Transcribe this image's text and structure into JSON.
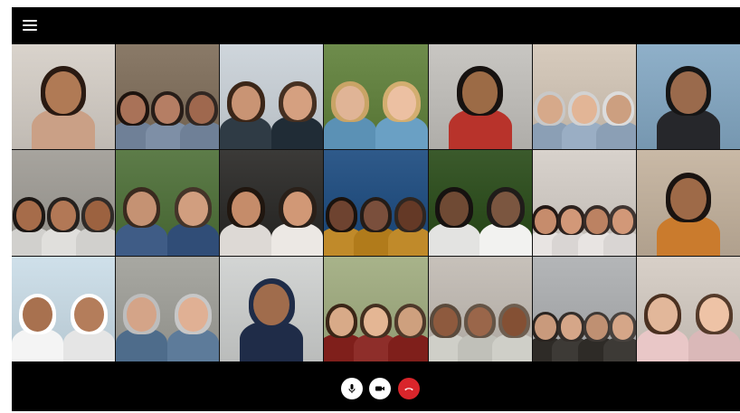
{
  "topbar": {
    "menu_icon": "hamburger-menu-icon"
  },
  "participants": [
    {
      "name": "participant-1",
      "bg": "#d9d3cc",
      "skin": "#b07a55",
      "hair": "#2a1a12",
      "shirt": "#caa086",
      "count": 1
    },
    {
      "name": "participant-2",
      "bg": "#8a7a68",
      "skin": "#a97258",
      "hair": "#1d130e",
      "shirt": "#7e8fa6",
      "count": 3
    },
    {
      "name": "participant-3",
      "bg": "#cfd6dc",
      "skin": "#c99474",
      "hair": "#3b2618",
      "shirt": "#2f3b45",
      "count": 2
    },
    {
      "name": "participant-4",
      "bg": "#6e8c4c",
      "skin": "#e0b496",
      "hair": "#c9a466",
      "shirt": "#6aa0c4",
      "count": 2
    },
    {
      "name": "participant-5",
      "bg": "#c8c6c2",
      "skin": "#9c6b46",
      "hair": "#171210",
      "shirt": "#b8332b",
      "count": 1
    },
    {
      "name": "participant-6",
      "bg": "#d7cbbd",
      "skin": "#d6a98a",
      "hair": "#c8c8c8",
      "shirt": "#9aaec4",
      "count": 3
    },
    {
      "name": "participant-7",
      "bg": "#8fb0c9",
      "skin": "#9a6a4c",
      "hair": "#151515",
      "shirt": "#26272b",
      "count": 1
    },
    {
      "name": "participant-8",
      "bg": "#a7a49e",
      "skin": "#a66c4a",
      "hair": "#1c1714",
      "shirt": "#e0dfdc",
      "count": 3
    },
    {
      "name": "participant-9",
      "bg": "#5d7c49",
      "skin": "#c59273",
      "hair": "#3a2a1f",
      "shirt": "#3f5c86",
      "count": 2
    },
    {
      "name": "participant-10",
      "bg": "#3b3a38",
      "skin": "#c58c6a",
      "hair": "#20160f",
      "shirt": "#ece8e4",
      "count": 2
    },
    {
      "name": "participant-11",
      "bg": "#2f5a8a",
      "skin": "#6e4330",
      "hair": "#1a120d",
      "shirt": "#c08a2a",
      "count": 3
    },
    {
      "name": "participant-12",
      "bg": "#3b5a2c",
      "skin": "#6f4a34",
      "hair": "#161210",
      "shirt": "#f2f2f0",
      "count": 2
    },
    {
      "name": "participant-13",
      "bg": "#d8d2cc",
      "skin": "#c68c6c",
      "hair": "#231814",
      "shirt": "#e8e4e2",
      "count": 4
    },
    {
      "name": "participant-14",
      "bg": "#c9b9a6",
      "skin": "#9e6a48",
      "hair": "#1a1310",
      "shirt": "#d98a3c",
      "count": 1
    },
    {
      "name": "participant-15",
      "bg": "#cfe0ea",
      "skin": "#a8714f",
      "hair": "#ffffff",
      "shirt": "#f4f4f4",
      "count": 2
    },
    {
      "name": "participant-16",
      "bg": "#a8a8a2",
      "skin": "#d4a488",
      "hair": "#bdbdbd",
      "shirt": "#5d7b9a",
      "count": 2
    },
    {
      "name": "participant-17",
      "bg": "#d3d5d4",
      "skin": "#a06c4c",
      "hair": "#1f2c48",
      "shirt": "#1f2c48",
      "count": 1
    },
    {
      "name": "participant-18",
      "bg": "#a8b38a",
      "skin": "#d8aa88",
      "hair": "#3a2516",
      "shirt": "#8e2e2a",
      "count": 3
    },
    {
      "name": "participant-19",
      "bg": "#c7c1ba",
      "skin": "#8e5a3e",
      "hair": "#5a4a3c",
      "shirt": "#cfcfc8",
      "count": 3
    },
    {
      "name": "participant-20",
      "bg": "#b4b6b8",
      "skin": "#c99a7c",
      "hair": "#2a2420",
      "shirt": "#3d3a36",
      "count": 4
    },
    {
      "name": "participant-21",
      "bg": "#d8d0c8",
      "skin": "#e2b79a",
      "hair": "#4a3020",
      "shirt": "#e9c7c7",
      "count": 2
    }
  ],
  "controls": {
    "mic_icon": "microphone-icon",
    "camera_icon": "video-camera-icon",
    "hangup_icon": "end-call-icon",
    "mic_color": "#ffffff",
    "camera_color": "#ffffff",
    "hangup_color": "#d9252b"
  }
}
